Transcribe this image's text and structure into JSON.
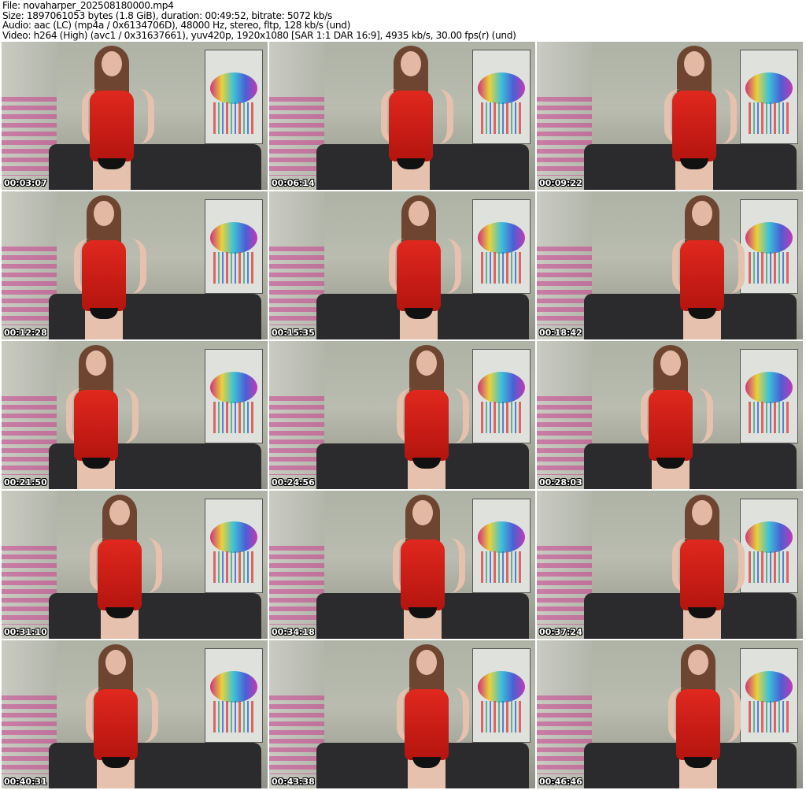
{
  "header": {
    "file": "File: novaharper_202508180000.mp4",
    "size": "Size: 1897061053 bytes (1.8 GiB), duration: 00:49:52, bitrate: 5072 kb/s",
    "audio": "Audio: aac (LC) (mp4a / 0x6134706D), 48000 Hz, stereo, fltp, 128 kb/s (und)",
    "video": "Video: h264 (High) (avc1 / 0x31637661), yuv420p, 1920x1080 [SAR 1:1 DAR 16:9], 4935 kb/s, 30.00 fps(r) (und)"
  },
  "thumbnails": [
    {
      "time": "00:03:07"
    },
    {
      "time": "00:06:14"
    },
    {
      "time": "00:09:22"
    },
    {
      "time": "00:12:28"
    },
    {
      "time": "00:15:35"
    },
    {
      "time": "00:18:42"
    },
    {
      "time": "00:21:50"
    },
    {
      "time": "00:24:56"
    },
    {
      "time": "00:28:03"
    },
    {
      "time": "00:31:10"
    },
    {
      "time": "00:34:18"
    },
    {
      "time": "00:37:24"
    },
    {
      "time": "00:40:31"
    },
    {
      "time": "00:43:38"
    },
    {
      "time": "00:46:46"
    }
  ]
}
